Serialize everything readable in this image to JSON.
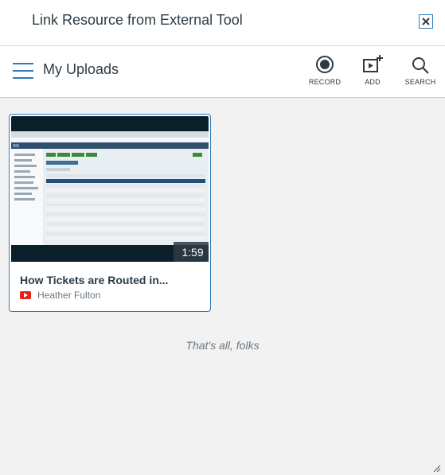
{
  "dialog": {
    "title": "Link Resource from External Tool",
    "close_icon": "close-icon"
  },
  "toolbar": {
    "title": "My Uploads",
    "menu_icon": "hamburger-menu-icon",
    "actions": [
      {
        "label": "RECORD",
        "icon": "record-icon"
      },
      {
        "label": "ADD",
        "icon": "add-video-icon"
      },
      {
        "label": "SEARCH",
        "icon": "search-icon"
      }
    ]
  },
  "media": [
    {
      "title": "How Tickets are Routed in...",
      "author": "Heather Fulton",
      "duration": "1:59",
      "source_icon": "youtube-icon"
    }
  ],
  "end_message": "That's all, folks",
  "colors": {
    "accent": "#2b7abc",
    "text": "#2d3b45",
    "muted": "#6b7780",
    "background": "#f2f2f2",
    "youtube": "#e62117"
  }
}
